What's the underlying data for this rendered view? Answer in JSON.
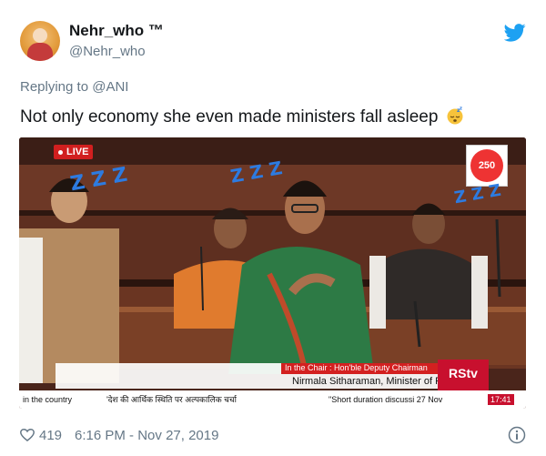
{
  "user": {
    "display_name": "Nehr_who ™",
    "handle": "@Nehr_who"
  },
  "reply": {
    "prefix": "Replying to ",
    "to": "@ANI"
  },
  "tweet": {
    "text": "Not only economy she even made ministers fall asleep"
  },
  "media": {
    "live_label": "LIVE",
    "logo_text": "250",
    "chair_caption": "In the Chair : Hon'ble Deputy Chairman",
    "speaker_caption": "Nirmala Sitharaman, Minister of Finance",
    "channel_logo": "RStv",
    "ticker_left": "in the country",
    "ticker_hindi": "'देश की आर्थिक स्थिति पर अल्पकालिक चर्चा",
    "ticker_right": "\"Short duration discussi 27 Nov",
    "ticker_time": "17:41",
    "zz_marks": [
      "Z Z Z",
      "Z Z Z",
      "Z Z Z"
    ]
  },
  "footer": {
    "likes": "419",
    "timestamp": "6:16 PM - Nov 27, 2019"
  },
  "colors": {
    "twitter_blue": "#1da1f2",
    "text_gray": "#657786",
    "zz_blue": "#2d7be0",
    "live_red": "#d11f1f"
  },
  "icons": [
    "twitter-icon",
    "sleepy-emoji-icon",
    "heart-icon",
    "info-icon"
  ]
}
